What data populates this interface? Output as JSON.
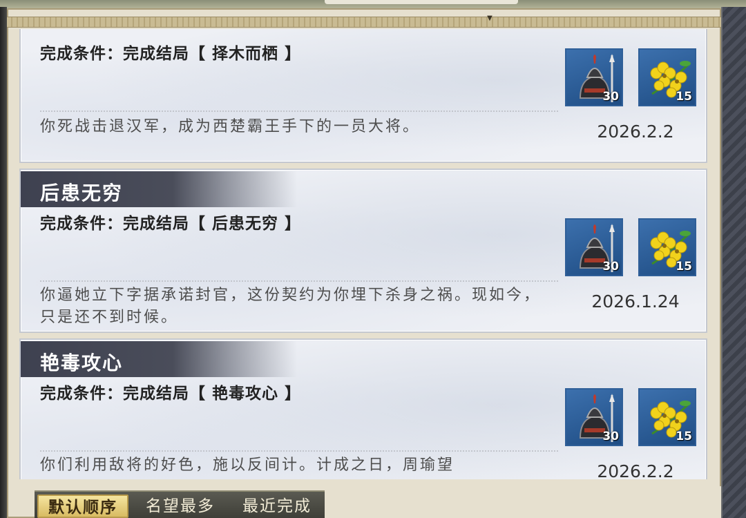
{
  "cards": [
    {
      "title": "",
      "condition": "完成条件：完成结局【 择木而栖 】",
      "description": "你死战击退汉军，成为西楚霸王手下的一员大将。",
      "date": "2026.2.2",
      "rewards": [
        {
          "icon": "helmet-spear-icon",
          "count": "30"
        },
        {
          "icon": "yellow-flower-icon",
          "count": "15"
        }
      ]
    },
    {
      "title": "后患无穷",
      "condition": "完成条件：完成结局【 后患无穷 】",
      "description": "你逼她立下字据承诺封官，这份契约为你埋下杀身之祸。现如今，只是还不到时候。",
      "date": "2026.1.24",
      "rewards": [
        {
          "icon": "helmet-spear-icon",
          "count": "30"
        },
        {
          "icon": "yellow-flower-icon",
          "count": "15"
        }
      ]
    },
    {
      "title": "艳毒攻心",
      "condition": "完成条件：完成结局【 艳毒攻心 】",
      "description": "你们利用敌将的好色，施以反间计。计成之日，周瑜望",
      "date": "2026.2.2",
      "rewards": [
        {
          "icon": "helmet-spear-icon",
          "count": "30"
        },
        {
          "icon": "yellow-flower-icon",
          "count": "15"
        }
      ]
    }
  ],
  "sort_tabs": [
    {
      "label": "默认顺序",
      "active": true
    },
    {
      "label": "名望最多",
      "active": false
    },
    {
      "label": "最近完成",
      "active": false
    }
  ],
  "colors": {
    "reward_bg": "#2a5e9c",
    "active_tab": "#e8cf7a",
    "banner": "#434656"
  }
}
